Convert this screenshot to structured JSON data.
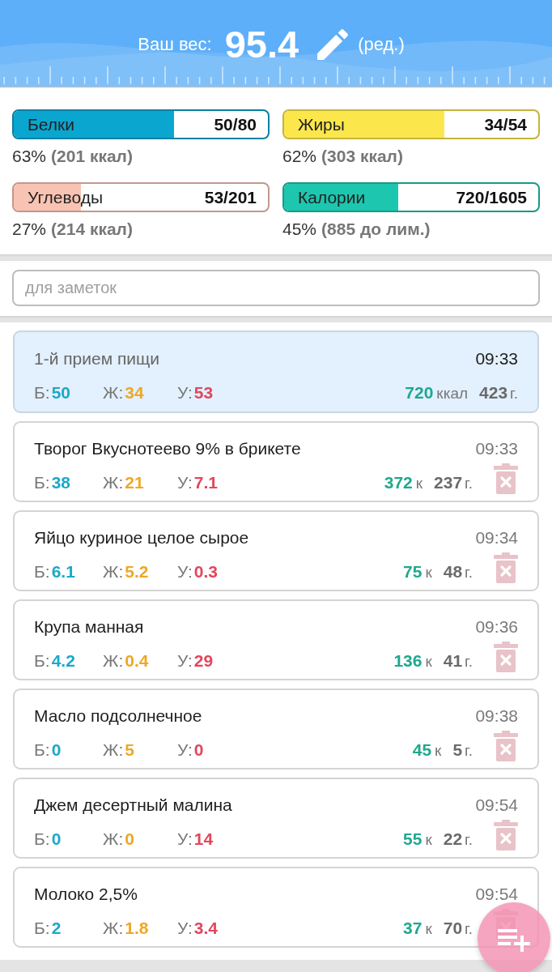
{
  "header": {
    "label": "Ваш вес:",
    "weight": "95.4",
    "edit_label": "(ред.)"
  },
  "goals": [
    {
      "name": "Белки",
      "value": "50/80",
      "level": 0.63,
      "color": "#0aa6cf",
      "percent": "63%",
      "detail": "(201 ккал)"
    },
    {
      "name": "Жиры",
      "value": "34/54",
      "level": 0.63,
      "color": "#fbe74c",
      "percent": "62%",
      "detail": "(303 ккал)"
    },
    {
      "name": "Углеводы",
      "value": "53/201",
      "level": 0.265,
      "color": "#f9c3b3",
      "percent": "27%",
      "detail": "(214 ккал)"
    },
    {
      "name": "Калории",
      "value": "720/1605",
      "level": 0.45,
      "color": "#1dc6ae",
      "percent": "45%",
      "detail": "(885 до лим.)"
    }
  ],
  "notes": {
    "placeholder": "для заметок"
  },
  "entries": [
    {
      "kind": "meal",
      "title": "1-й прием пищи",
      "time": "09:33",
      "macros": [
        {
          "label": "Б:",
          "value": "50",
          "color": "#1aa9c9"
        },
        {
          "label": "Ж:",
          "value": "34",
          "color": "#eea824"
        },
        {
          "label": "У:",
          "value": "53",
          "color": "#e2475b"
        }
      ],
      "kcal": "720",
      "kcal_unit": "ккал",
      "weight": "423",
      "weight_unit": "г."
    },
    {
      "kind": "food",
      "title": "Творог Вкуснотеево 9% в брикете",
      "time": "09:33",
      "macros": [
        {
          "label": "Б:",
          "value": "38",
          "color": "#1aa9c9"
        },
        {
          "label": "Ж:",
          "value": "21",
          "color": "#eea824"
        },
        {
          "label": "У:",
          "value": "7.1",
          "color": "#e2475b"
        }
      ],
      "kcal": "372",
      "kcal_unit": "к",
      "weight": "237",
      "weight_unit": "г."
    },
    {
      "kind": "food",
      "title": "Яйцо куриное целое сырое",
      "time": "09:34",
      "macros": [
        {
          "label": "Б:",
          "value": "6.1",
          "color": "#1aa9c9"
        },
        {
          "label": "Ж:",
          "value": "5.2",
          "color": "#eea824"
        },
        {
          "label": "У:",
          "value": "0.3",
          "color": "#e2475b"
        }
      ],
      "kcal": "75",
      "kcal_unit": "к",
      "weight": "48",
      "weight_unit": "г."
    },
    {
      "kind": "food",
      "title": "Крупа манная",
      "time": "09:36",
      "macros": [
        {
          "label": "Б:",
          "value": "4.2",
          "color": "#1aa9c9"
        },
        {
          "label": "Ж:",
          "value": "0.4",
          "color": "#eea824"
        },
        {
          "label": "У:",
          "value": "29",
          "color": "#e2475b"
        }
      ],
      "kcal": "136",
      "kcal_unit": "к",
      "weight": "41",
      "weight_unit": "г."
    },
    {
      "kind": "food",
      "title": "Масло подсолнечное",
      "time": "09:38",
      "macros": [
        {
          "label": "Б:",
          "value": "0",
          "color": "#1aa9c9"
        },
        {
          "label": "Ж:",
          "value": "5",
          "color": "#eea824"
        },
        {
          "label": "У:",
          "value": "0",
          "color": "#e2475b"
        }
      ],
      "kcal": "45",
      "kcal_unit": "к",
      "weight": "5",
      "weight_unit": "г."
    },
    {
      "kind": "food",
      "title": "Джем десертный малина",
      "time": "09:54",
      "macros": [
        {
          "label": "Б:",
          "value": "0",
          "color": "#1aa9c9"
        },
        {
          "label": "Ж:",
          "value": "0",
          "color": "#eea824"
        },
        {
          "label": "У:",
          "value": "14",
          "color": "#e2475b"
        }
      ],
      "kcal": "55",
      "kcal_unit": "к",
      "weight": "22",
      "weight_unit": "г."
    },
    {
      "kind": "food",
      "title": "Молоко 2,5%",
      "time": "09:54",
      "macros": [
        {
          "label": "Б:",
          "value": "2",
          "color": "#1aa9c9"
        },
        {
          "label": "Ж:",
          "value": "1.8",
          "color": "#eea824"
        },
        {
          "label": "У:",
          "value": "3.4",
          "color": "#e2475b"
        }
      ],
      "kcal": "37",
      "kcal_unit": "к",
      "weight": "70",
      "weight_unit": "г."
    }
  ]
}
